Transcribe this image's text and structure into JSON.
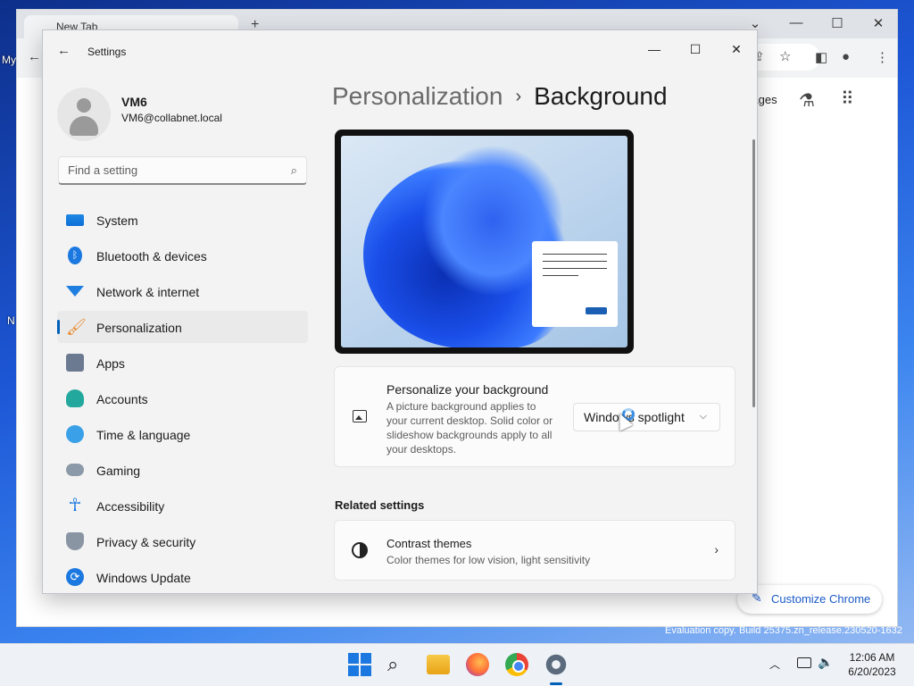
{
  "desktop": {
    "labels": [
      "My",
      "N"
    ],
    "evaluation_text": "Evaluation copy. Build 25375.zn_release.230520-1632"
  },
  "chrome": {
    "tab_title": "New Tab",
    "images_link": "Images",
    "customize_label": "Customize Chrome"
  },
  "settings": {
    "app_title": "Settings",
    "user": {
      "name": "VM6",
      "email": "VM6@collabnet.local"
    },
    "search_placeholder": "Find a setting",
    "nav": [
      {
        "label": "System",
        "icon": "system-icon"
      },
      {
        "label": "Bluetooth & devices",
        "icon": "bluetooth-icon"
      },
      {
        "label": "Network & internet",
        "icon": "wifi-icon"
      },
      {
        "label": "Personalization",
        "icon": "brush-icon",
        "selected": true
      },
      {
        "label": "Apps",
        "icon": "apps-icon"
      },
      {
        "label": "Accounts",
        "icon": "person-icon"
      },
      {
        "label": "Time & language",
        "icon": "globe-clock-icon"
      },
      {
        "label": "Gaming",
        "icon": "gamepad-icon"
      },
      {
        "label": "Accessibility",
        "icon": "accessibility-icon"
      },
      {
        "label": "Privacy & security",
        "icon": "shield-icon"
      },
      {
        "label": "Windows Update",
        "icon": "update-icon"
      }
    ],
    "breadcrumb": {
      "parent": "Personalization",
      "separator": "›",
      "current": "Background"
    },
    "personalize_card": {
      "title": "Personalize your background",
      "description": "A picture background applies to your current desktop. Solid color or slideshow backgrounds apply to all your desktops.",
      "dropdown_value": "Windows spotlight"
    },
    "related_heading": "Related settings",
    "contrast_card": {
      "title": "Contrast themes",
      "description": "Color themes for low vision, light sensitivity"
    }
  },
  "taskbar": {
    "apps": [
      "start-icon",
      "search-icon",
      "file-explorer-icon",
      "firefox-icon",
      "chrome-icon",
      "settings-icon"
    ],
    "time": "12:06 AM",
    "date": "6/20/2023"
  },
  "colors": {
    "accent": "#005fb8",
    "window_bg": "#f3f3f3"
  }
}
